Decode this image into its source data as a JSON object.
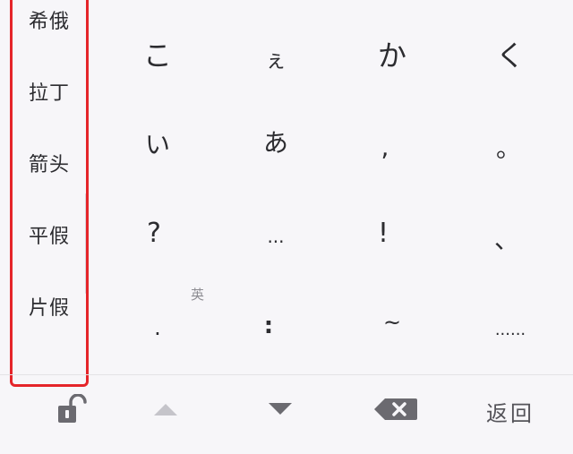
{
  "categories": [
    {
      "label": "希俄"
    },
    {
      "label": "拉丁"
    },
    {
      "label": "箭头"
    },
    {
      "label": "平假"
    },
    {
      "label": "片假"
    }
  ],
  "keys": {
    "row1": [
      "こ",
      "ぇ",
      "か",
      "く"
    ],
    "row2": [
      "い",
      "あ",
      ",",
      "。"
    ],
    "row3": [
      "?",
      "...",
      "!",
      "、"
    ],
    "row4": [
      ".",
      ":",
      "~",
      "......"
    ]
  },
  "sub_label": "英",
  "bottom_bar": {
    "lock_icon": "unlock-icon",
    "up_icon": "triangle-up-icon",
    "down_icon": "triangle-down-icon",
    "backspace_icon": "backspace-icon",
    "back_label": "返回"
  },
  "colors": {
    "highlight_border": "#e5252a",
    "background": "#f7f6f9",
    "key_text": "#2c2c30",
    "icon_gray": "#6b6a70",
    "icon_light": "#c5c4ca"
  }
}
